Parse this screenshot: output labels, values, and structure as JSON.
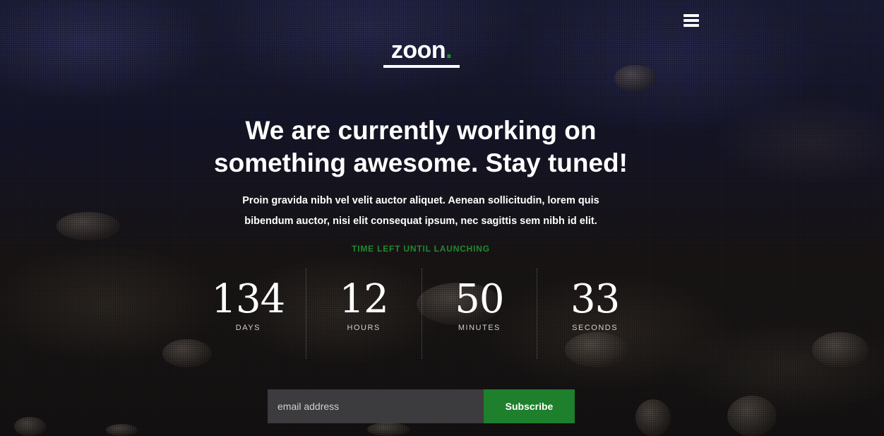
{
  "logo": {
    "text": "zoon",
    "dot": "."
  },
  "headline": {
    "line1": "We are currently working on",
    "line2": "something awesome. Stay tuned!"
  },
  "description": {
    "line1": "Proin gravida nibh vel velit auctor aliquet. Aenean sollicitudin, lorem quis",
    "line2": "bibendum auctor, nisi elit consequat ipsum, nec sagittis sem nibh id elit."
  },
  "countdown": {
    "heading": "TIME LEFT UNTIL LAUNCHING",
    "units": [
      {
        "value": "134",
        "label": "DAYS"
      },
      {
        "value": "12",
        "label": "HOURS"
      },
      {
        "value": "50",
        "label": "MINUTES"
      },
      {
        "value": "33",
        "label": "SECONDS"
      }
    ]
  },
  "subscribe_form": {
    "email_placeholder": "email address",
    "button_label": "Subscribe"
  },
  "colors": {
    "accent": "#1e8a2e",
    "button": "#1e7f2c"
  },
  "icons": {
    "menu": "hamburger-menu-icon"
  }
}
